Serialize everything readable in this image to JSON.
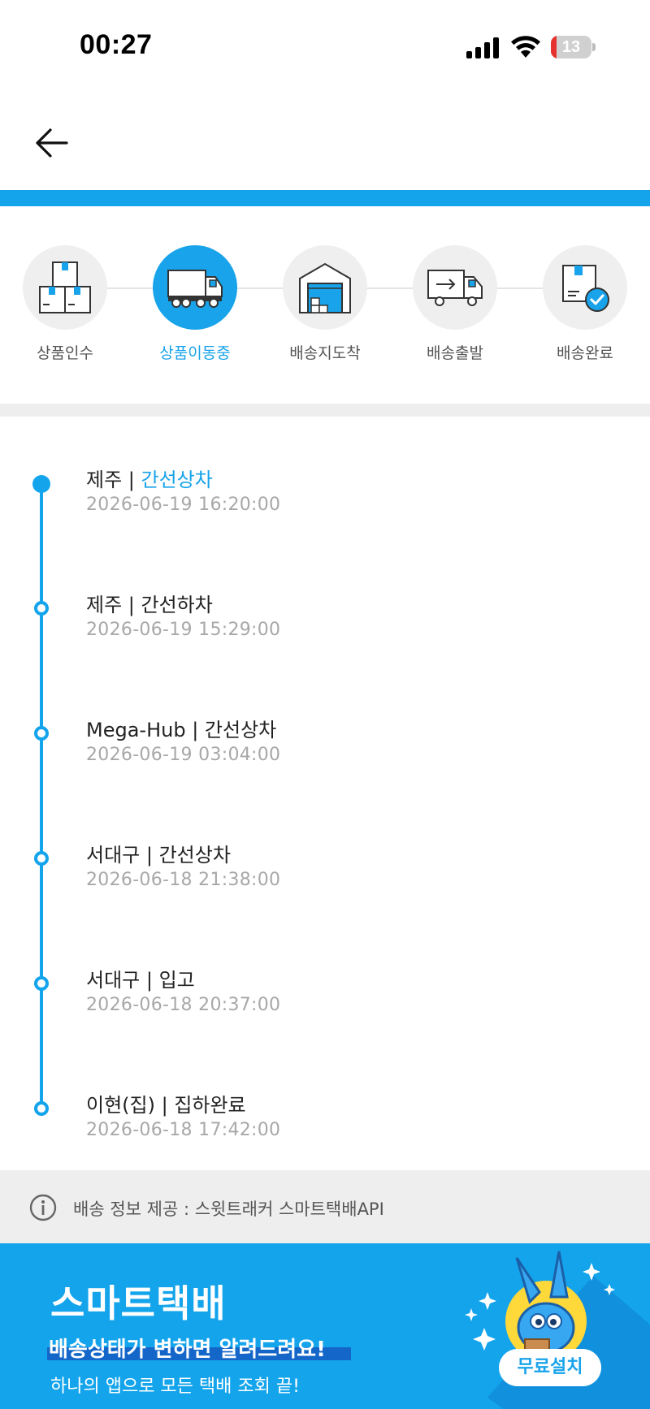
{
  "status_bar": {
    "time": "00:27",
    "battery_level": "13",
    "battery_fraction": 0.13
  },
  "steps": [
    {
      "label": "상품인수",
      "icon": "boxes-icon",
      "active": false
    },
    {
      "label": "상품이동중",
      "icon": "truck-icon",
      "active": true
    },
    {
      "label": "배송지도착",
      "icon": "warehouse-icon",
      "active": false
    },
    {
      "label": "배송출발",
      "icon": "delivery-van-icon",
      "active": false
    },
    {
      "label": "배송완료",
      "icon": "box-check-icon",
      "active": false
    }
  ],
  "timeline": [
    {
      "location": "제주",
      "separator": " | ",
      "status": "간선상차",
      "datetime": "2026-06-19 16:20:00",
      "highlight": true
    },
    {
      "location": "제주",
      "separator": " | ",
      "status": "간선하차",
      "datetime": "2026-06-19 15:29:00",
      "highlight": false
    },
    {
      "location": "Mega-Hub",
      "separator": " | ",
      "status": "간선상차",
      "datetime": "2026-06-19 03:04:00",
      "highlight": false
    },
    {
      "location": "서대구",
      "separator": " | ",
      "status": "간선상차",
      "datetime": "2026-06-18 21:38:00",
      "highlight": false
    },
    {
      "location": "서대구",
      "separator": " | ",
      "status": "입고",
      "datetime": "2026-06-18 20:37:00",
      "highlight": false
    },
    {
      "location": "이현(집)",
      "separator": " | ",
      "status": "집하완료",
      "datetime": "2026-06-18 17:42:00",
      "highlight": false
    }
  ],
  "info": {
    "text": "배송 정보 제공 : 스윗트래커 스마트택배API"
  },
  "banner": {
    "brand": "스마트택배",
    "headline": "배송상태가 변하면 알려드려요!",
    "subline": "하나의 앱으로 모든 택배 조회 끝!",
    "button": "무료설치"
  },
  "colors": {
    "accent": "#13a4ec",
    "active_text": "#18a3ea",
    "battery_low": "#e5322e",
    "headline_highlight": "#1467c9"
  }
}
